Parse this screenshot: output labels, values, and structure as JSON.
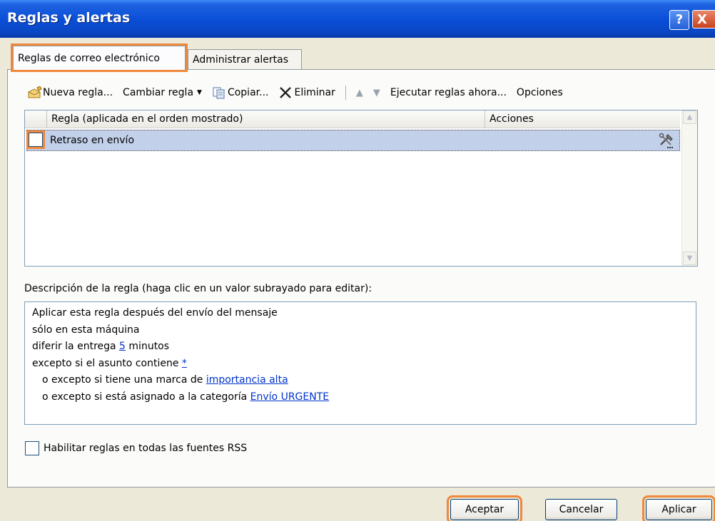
{
  "window": {
    "title": "Reglas y alertas",
    "help_label": "?",
    "close_label": "X"
  },
  "tabs": [
    {
      "label": "Reglas de correo electrónico",
      "active": true
    },
    {
      "label": "Administrar alertas",
      "active": false
    }
  ],
  "toolbar": {
    "new_rule": "Nueva regla...",
    "change_rule": "Cambiar regla",
    "copy": "Copiar...",
    "delete": "Eliminar",
    "run_rules": "Ejecutar reglas ahora...",
    "options": "Opciones"
  },
  "rules_list": {
    "columns": [
      "Regla (aplicada en el orden mostrado)",
      "Acciones"
    ],
    "rows": [
      {
        "name": "Retraso en envío",
        "checked": false
      }
    ]
  },
  "description": {
    "label": "Descripción de la regla (haga clic en un valor subrayado para editar):",
    "line1": "Aplicar esta regla después del envío del mensaje",
    "line2": "sólo en esta máquina",
    "line3_pre": "diferir la entrega ",
    "line3_link": "5",
    "line3_post": " minutos",
    "line4_pre": "excepto si el asunto contiene ",
    "line4_link": "*",
    "line5_pre": "o excepto si tiene una marca de ",
    "line5_link": "importancia alta",
    "line6_pre": "o excepto si está asignado a la categoría ",
    "line6_link": "Envío URGENTE"
  },
  "rss_checkbox": {
    "label": "Habilitar reglas en todas las fuentes RSS",
    "checked": false
  },
  "buttons": {
    "ok": "Aceptar",
    "cancel": "Cancelar",
    "apply": "Aplicar"
  },
  "colors": {
    "titlebar": "#0a4fd8",
    "highlight": "#f0883c",
    "selected_row": "#c2d0ea",
    "link": "#0033cc"
  },
  "icons": [
    "new-rule-icon",
    "copy-icon",
    "delete-icon",
    "move-up-icon",
    "move-down-icon",
    "tools-icon"
  ]
}
